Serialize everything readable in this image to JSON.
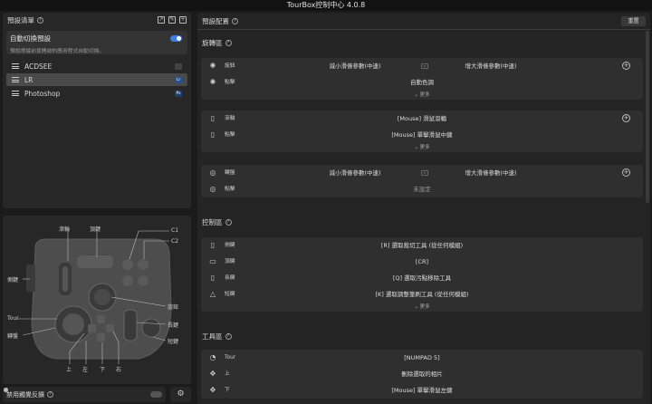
{
  "app": {
    "title": "TourBox控制中心 4.0.8"
  },
  "preset_panel": {
    "title": "預設清單",
    "help": "?",
    "auto_switch": {
      "title": "自動切換預設",
      "desc": "預設根據前景開啟的應用程式自動切換。",
      "enabled": true
    },
    "presets": [
      {
        "name": "ACDSEE",
        "badge": "",
        "selected": false,
        "badge_color": "#444444"
      },
      {
        "name": "LR",
        "badge": "Lr",
        "selected": true,
        "badge_color": "#2a4f8f"
      },
      {
        "name": "Photoshop",
        "badge": "Ps",
        "selected": false,
        "badge_color": "#1e3e6e"
      }
    ]
  },
  "device": {
    "labels": {
      "scroll": "滾輪",
      "tall": "長鍵",
      "short": "短鍵",
      "side": "側鍵",
      "top": "頂鍵",
      "c1": "C1",
      "c2": "C2",
      "knob": "旋鈕",
      "tour": "Tour",
      "dial": "轉盤",
      "up": "上",
      "left": "左",
      "down": "下",
      "right": "右"
    }
  },
  "bottom": {
    "haptic_label": "禁用觸覺反饋",
    "haptic_enabled": false
  },
  "config": {
    "title": "預設配置",
    "help": "?",
    "reset": "重置",
    "more": "更多",
    "sections": {
      "rotary": "旋轉區",
      "control": "控制區",
      "tool": "工具區"
    },
    "knob": {
      "rotate": "旋鈕",
      "left": "減小滑條參數(中速)",
      "right": "增大滑條參數(中速)",
      "click": "點擊",
      "click_value": "自動色調"
    },
    "scroll": {
      "scroll": "滾輪",
      "scroll_value": "[Mouse] 滑鼠滾輪",
      "click": "點擊",
      "click_value": "[Mouse] 單擊滑鼠中鍵"
    },
    "dial": {
      "rotate": "轉盤",
      "left": "減小滑條參數(中速)",
      "right": "增大滑條參數(中速)",
      "click": "點擊",
      "click_value": "未設定"
    },
    "control_rows": [
      {
        "name": "側鍵",
        "value": "[R] 選取裁切工具 (從任何模組)",
        "icon": "▯"
      },
      {
        "name": "頂鍵",
        "value": "[CR]",
        "icon": "▭"
      },
      {
        "name": "長鍵",
        "value": "[Q] 選取污點移除工具",
        "icon": "▯"
      },
      {
        "name": "短鍵",
        "value": "[K] 選取調整筆刷工具 (從任何模組)",
        "icon": "△"
      }
    ],
    "tool_rows": [
      {
        "name": "Tour",
        "value": "[NUMPAD 5]",
        "icon": "◔"
      },
      {
        "name": "上",
        "value": "刪除選取的相片",
        "icon": "✥"
      },
      {
        "name": "下",
        "value": "[Mouse] 單擊滑鼠左鍵",
        "icon": "✥"
      }
    ]
  }
}
